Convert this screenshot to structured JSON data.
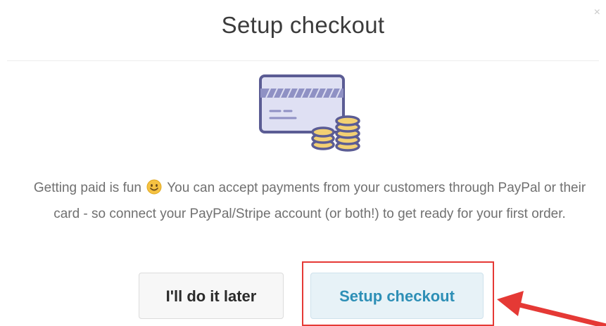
{
  "modal": {
    "title": "Setup checkout",
    "close_label": "×",
    "description_part1": "Getting paid is fun",
    "description_part2": "You can accept payments from your customers through PayPal or their card - so connect your PayPal/Stripe account (or both!) to get ready for your first order.",
    "later_button": "I'll do it later",
    "setup_button": "Setup checkout"
  },
  "icons": {
    "illustration": "credit-card-coins-icon",
    "emoji": "smiley-emoji-icon",
    "close": "close-icon",
    "annotation_arrow": "arrow-icon"
  },
  "colors": {
    "illustration_stroke": "#5b5c94",
    "illustration_fill": "#dfe0f3",
    "coin_fill": "#f2d073",
    "setup_text": "#2d8fb6",
    "annotation_red": "#e53935"
  }
}
